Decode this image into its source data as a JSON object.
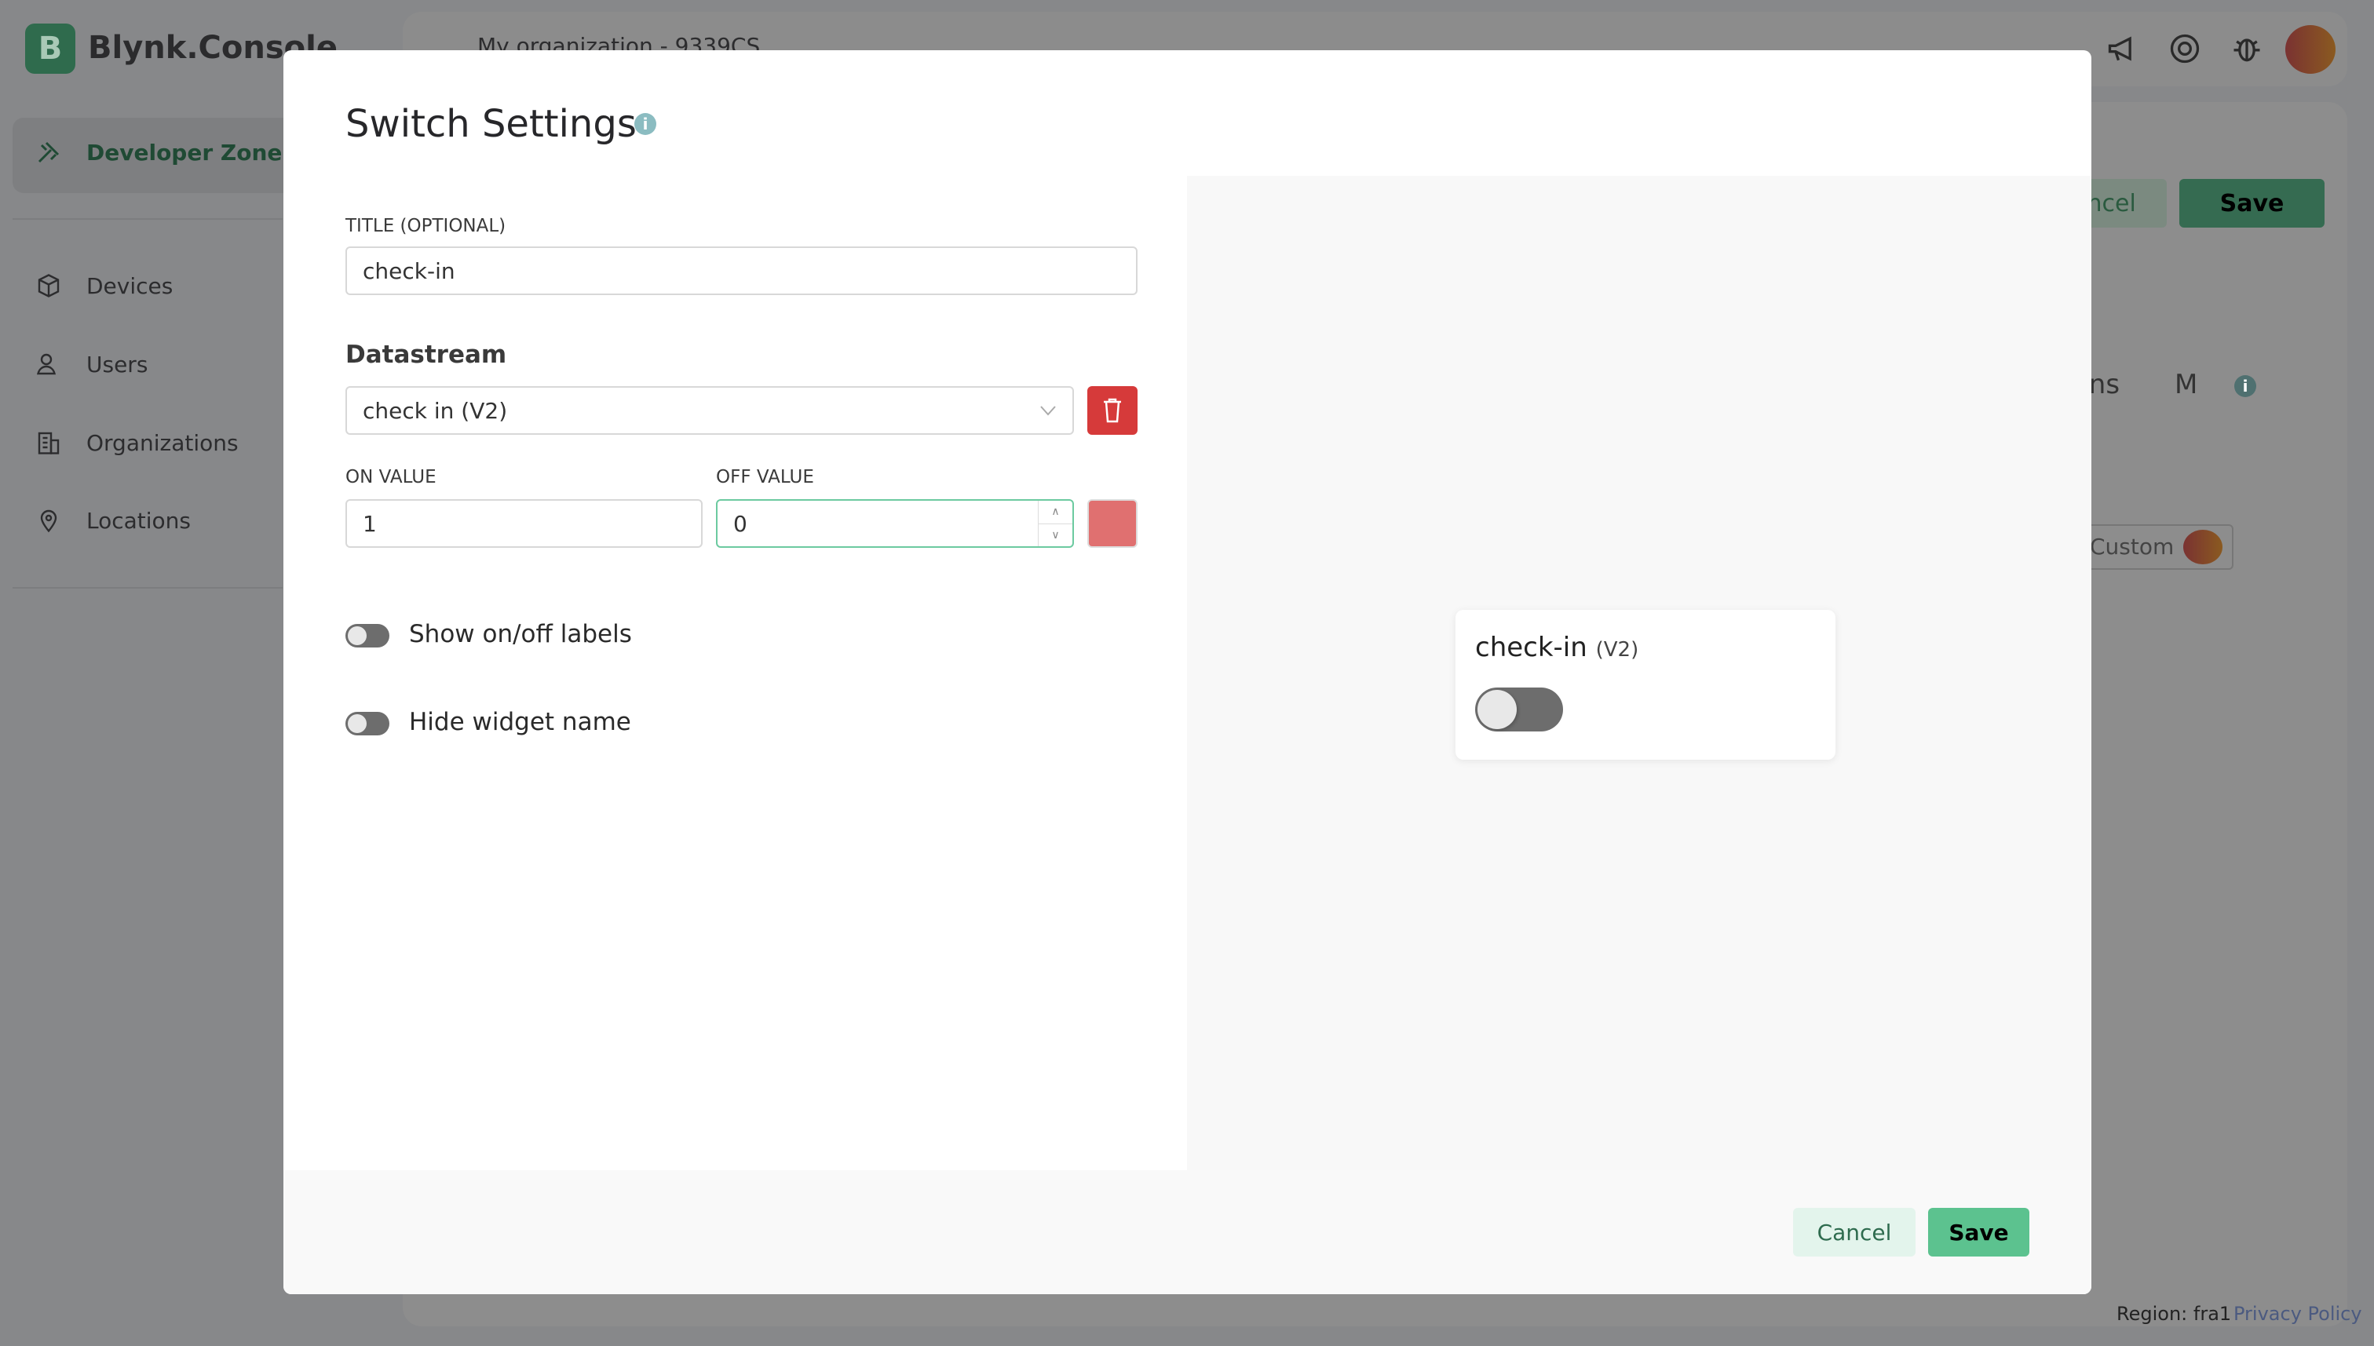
{
  "app": {
    "brand": "Blynk.Console",
    "logo_letter": "B"
  },
  "sidebar": {
    "items": [
      {
        "label": "Developer Zone",
        "icon": "tools-icon"
      },
      {
        "label": "Devices",
        "icon": "cube-icon"
      },
      {
        "label": "Users",
        "icon": "users-icon"
      },
      {
        "label": "Organizations",
        "icon": "building-icon"
      },
      {
        "label": "Locations",
        "icon": "pin-icon"
      }
    ]
  },
  "topbar": {
    "organization": "My organization - 9339CS"
  },
  "background": {
    "cancel_label": "Cancel",
    "save_label": "Save",
    "tab_partial": "ons",
    "tab_m": "M",
    "custom_label": "Custom"
  },
  "footer": {
    "region": "Region: fra1",
    "privacy": "Privacy Policy"
  },
  "modal": {
    "title": "Switch Settings",
    "title_label": "TITLE (OPTIONAL)",
    "title_value": "check-in",
    "datastream_heading": "Datastream",
    "datastream_value": "check in (V2)",
    "on_value_label": "ON VALUE",
    "on_value": "1",
    "off_value_label": "OFF VALUE",
    "off_value": "0",
    "color": "#e07070",
    "toggles": [
      {
        "label": "Show on/off labels",
        "on": false
      },
      {
        "label": "Hide widget name",
        "on": false
      }
    ],
    "preview": {
      "title": "check-in",
      "pin": "(V2)",
      "state": "off"
    },
    "cancel_label": "Cancel",
    "save_label": "Save"
  },
  "colors": {
    "accent": "#5cc28f",
    "danger": "#d63a3a",
    "info": "#8bbcc1"
  }
}
